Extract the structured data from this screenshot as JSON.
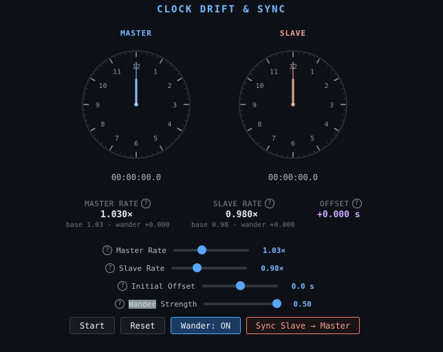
{
  "title": "CLOCK DRIFT & SYNC",
  "master": {
    "label": "MASTER",
    "time": "00:00:00.0",
    "hand_color": "#a8c8f0",
    "accent": "#79b8ff"
  },
  "slave": {
    "label": "SLAVE",
    "time": "00:00:00.0",
    "hand_color": "#e0a8a0",
    "accent": "#f0a090"
  },
  "dial_numbers": [
    "12",
    "1",
    "2",
    "3",
    "4",
    "5",
    "6",
    "7",
    "8",
    "9",
    "10",
    "11"
  ],
  "stats": {
    "master_rate": {
      "title": "MASTER RATE",
      "value": "1.030×",
      "sub": "base 1.03 · wander +0.000"
    },
    "slave_rate": {
      "title": "SLAVE RATE",
      "value": "0.980×",
      "sub": "base 0.98 · wander +0.000"
    },
    "offset": {
      "title": "OFFSET",
      "value": "+0.000 s"
    }
  },
  "help_glyph": "?",
  "sliders": {
    "master_rate": {
      "label": "Master Rate",
      "value_text": "1.03×",
      "fraction": 0.375
    },
    "slave_rate": {
      "label": "Slave Rate",
      "value_text": "0.98×",
      "fraction": 0.33
    },
    "initial_offset": {
      "label": "Initial Offset",
      "value_text": "0.0 s",
      "fraction": 0.5
    },
    "wander_strength": {
      "label_highlight": "Wander",
      "label_rest": " Strength",
      "value_text": "0.50",
      "fraction": 0.96
    }
  },
  "buttons": {
    "start": "Start",
    "reset": "Reset",
    "wander": "Wander: ON",
    "sync": "Sync Slave → Master"
  },
  "colors": {
    "background": "#0d1117",
    "accent_blue": "#58a6ff",
    "offset_value": "#d2a8ff"
  }
}
